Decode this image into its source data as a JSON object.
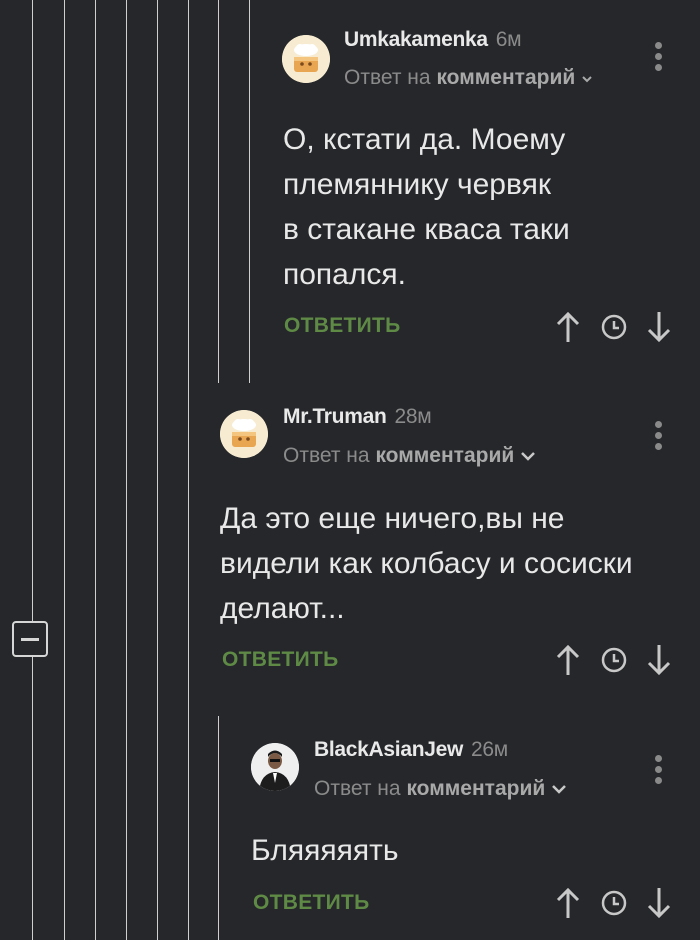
{
  "thread_controls": {
    "collapse_icon": "minus-box-icon"
  },
  "comments": [
    {
      "author": "Umkakamenka",
      "time": "6м",
      "reply_prefix": "Ответ на",
      "reply_target": "комментарий",
      "text_lines": [
        "О, кстати да. Моему",
        "племяннику червяк",
        "в стакане кваса таки",
        "попался."
      ],
      "reply_label": "ОТВЕТИТЬ",
      "avatar_icon": "cake-avatar-icon"
    },
    {
      "author": "Mr.Truman",
      "time": "28м",
      "reply_prefix": "Ответ на",
      "reply_target": "комментарий",
      "text_lines": [
        "Да это еще ничего,вы не",
        "видели как колбасу и сосиски",
        "делают..."
      ],
      "reply_label": "ОТВЕТИТЬ",
      "avatar_icon": "cake-avatar-icon"
    },
    {
      "author": "BlackAsianJew",
      "time": "26м",
      "reply_prefix": "Ответ на",
      "reply_target": "комментарий",
      "text_lines": [
        "Бляяяяять"
      ],
      "reply_label": "ОТВЕТИТЬ",
      "avatar_icon": "person-avatar-icon"
    }
  ],
  "colors": {
    "background": "#25272a",
    "reply_green": "#5e8a46",
    "meta_gray": "#8b8b8b"
  }
}
